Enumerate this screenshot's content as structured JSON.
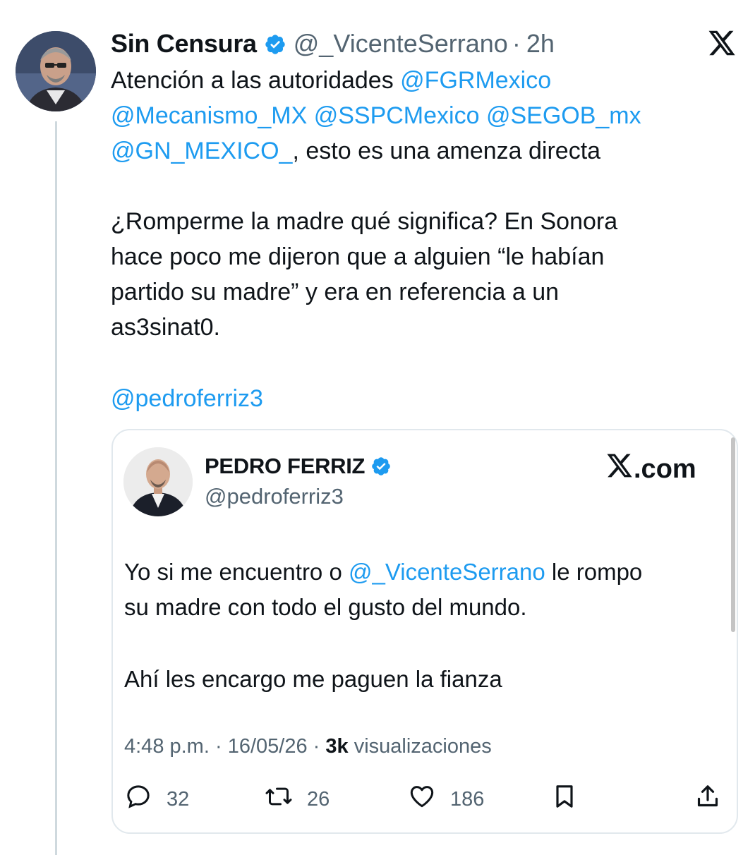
{
  "post": {
    "author_name": "Sin Censura",
    "handle": "@_VicenteSerrano",
    "separator": "·",
    "time": "2h",
    "lines": [
      {
        "t": "Atención a las autoridades ",
        "m": "@FGRMexico"
      },
      {
        "m": "@Mecanismo_MX @SSPCMexico @SEGOB_mx"
      },
      {
        "m": "@GN_MEXICO_",
        "t": ", esto es una amenza directa"
      },
      {
        "t": "¿Romperme la madre qué significa? En Sonora"
      },
      {
        "t": "hace poco me dijeron que a alguien “le habían"
      },
      {
        "t": "partido su madre” y era en referencia a un"
      },
      {
        "t": "as3sinat0."
      },
      {
        "m": "@pedroferriz3"
      }
    ]
  },
  "quoted": {
    "author_name": "PEDRO FERRIZ",
    "handle": "@pedroferriz3",
    "brand": ".com",
    "lines": [
      {
        "t": "Yo si me encuentro o ",
        "m": "@_VicenteSerrano",
        "t2": " le rompo"
      },
      {
        "t": "su madre con todo el gusto del mundo."
      },
      {
        "t": "Ahí les encargo me paguen la fianza"
      }
    ],
    "meta_time": "4:48 p.m.",
    "meta_date": "16/05/26",
    "meta_views_count": "3k",
    "meta_views_label": "visualizaciones",
    "meta_sep": " · ",
    "replies": "32",
    "reposts": "26",
    "likes": "186"
  },
  "icons": {
    "verified": "verified-badge-icon",
    "brand": "x-logo-icon",
    "reply": "reply-icon",
    "repost": "repost-icon",
    "like": "like-icon",
    "bookmark": "bookmark-icon",
    "share": "share-icon"
  },
  "colors": {
    "link": "#1d9bf0",
    "verified": "#1d9bf0",
    "muted": "#536471",
    "text": "#0f1419",
    "border": "#e1e8ed"
  }
}
